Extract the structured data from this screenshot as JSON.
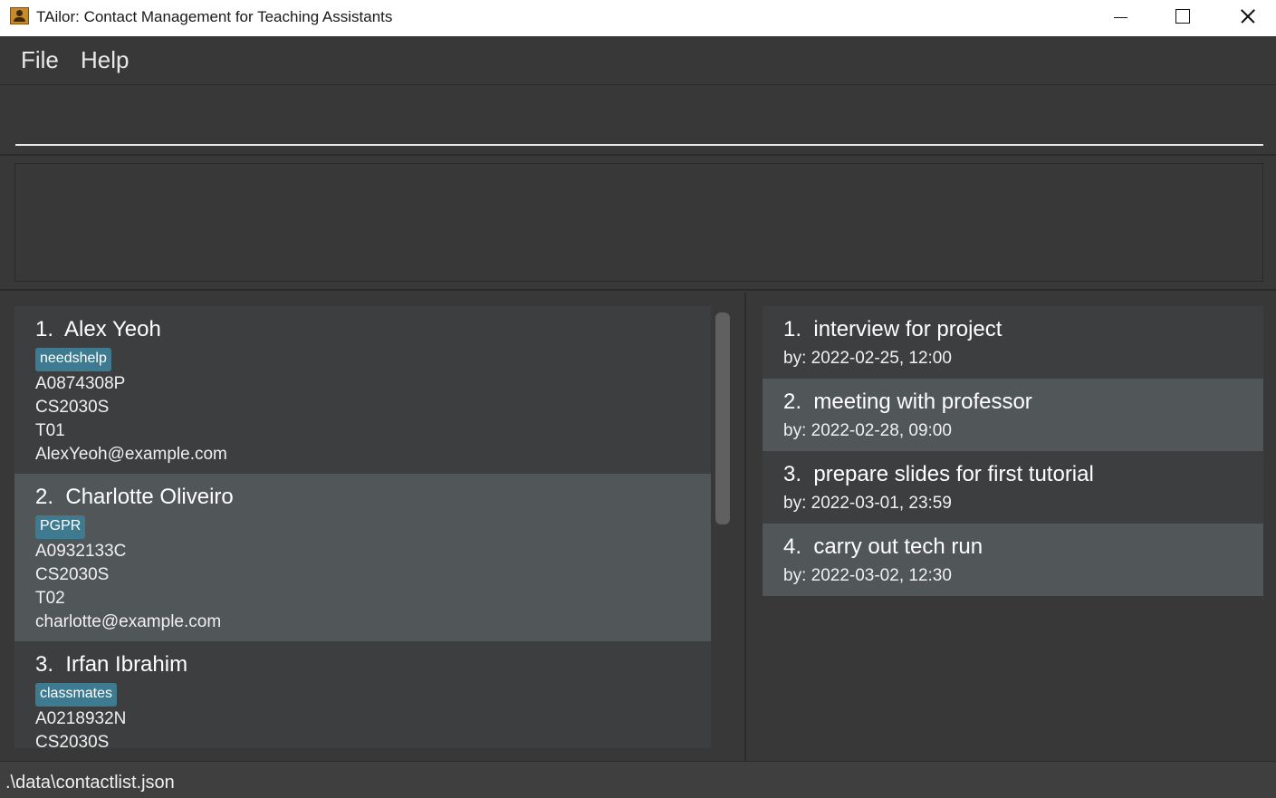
{
  "window": {
    "title": "TAilor: Contact Management for Teaching Assistants"
  },
  "menu": {
    "file": "File",
    "help": "Help"
  },
  "command": {
    "value": "",
    "placeholder": ""
  },
  "result": {
    "text": ""
  },
  "persons": [
    {
      "index": "1.",
      "name": "Alex Yeoh",
      "tag": "needshelp",
      "student_id": "A0874308P",
      "module": "CS2030S",
      "tutorial": "T01",
      "email": "AlexYeoh@example.com"
    },
    {
      "index": "2.",
      "name": "Charlotte Oliveiro",
      "tag": "PGPR",
      "student_id": "A0932133C",
      "module": "CS2030S",
      "tutorial": "T02",
      "email": "charlotte@example.com"
    },
    {
      "index": "3.",
      "name": "Irfan Ibrahim",
      "tag": "classmates",
      "student_id": "A0218932N",
      "module": "CS2030S",
      "tutorial": "",
      "email": ""
    }
  ],
  "tasks": [
    {
      "index": "1.",
      "title": "interview for project",
      "by": "by: 2022-02-25, 12:00"
    },
    {
      "index": "2.",
      "title": "meeting with professor",
      "by": "by: 2022-02-28, 09:00"
    },
    {
      "index": "3.",
      "title": "prepare slides for first tutorial",
      "by": "by: 2022-03-01, 23:59"
    },
    {
      "index": "4.",
      "title": "carry out tech run",
      "by": "by: 2022-03-02, 12:30"
    }
  ],
  "status": {
    "path": ".\\data\\contactlist.json"
  },
  "icons": {
    "app": "contact-book-icon",
    "minimize": "minimize-icon",
    "maximize": "maximize-icon",
    "close": "close-icon"
  },
  "colors": {
    "background": "#383838",
    "card_odd": "#3c3e3f",
    "card_even": "#515658",
    "tag": "#3e7b91"
  }
}
